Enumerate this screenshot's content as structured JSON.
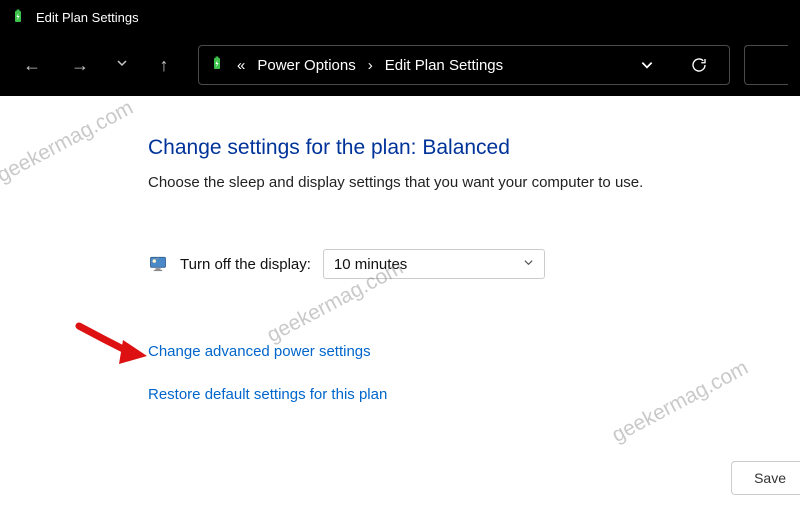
{
  "window": {
    "title": "Edit Plan Settings"
  },
  "breadcrumb": {
    "prefix": "«",
    "item1": "Power Options",
    "item2": "Edit Plan Settings"
  },
  "page": {
    "heading": "Change settings for the plan: Balanced",
    "subtitle": "Choose the sleep and display settings that you want your computer to use."
  },
  "display_off": {
    "label": "Turn off the display:",
    "value": "10 minutes"
  },
  "links": {
    "advanced": "Change advanced power settings",
    "restore": "Restore default settings for this plan"
  },
  "buttons": {
    "save": "Save"
  },
  "watermark": {
    "text": "geekermag.com"
  }
}
